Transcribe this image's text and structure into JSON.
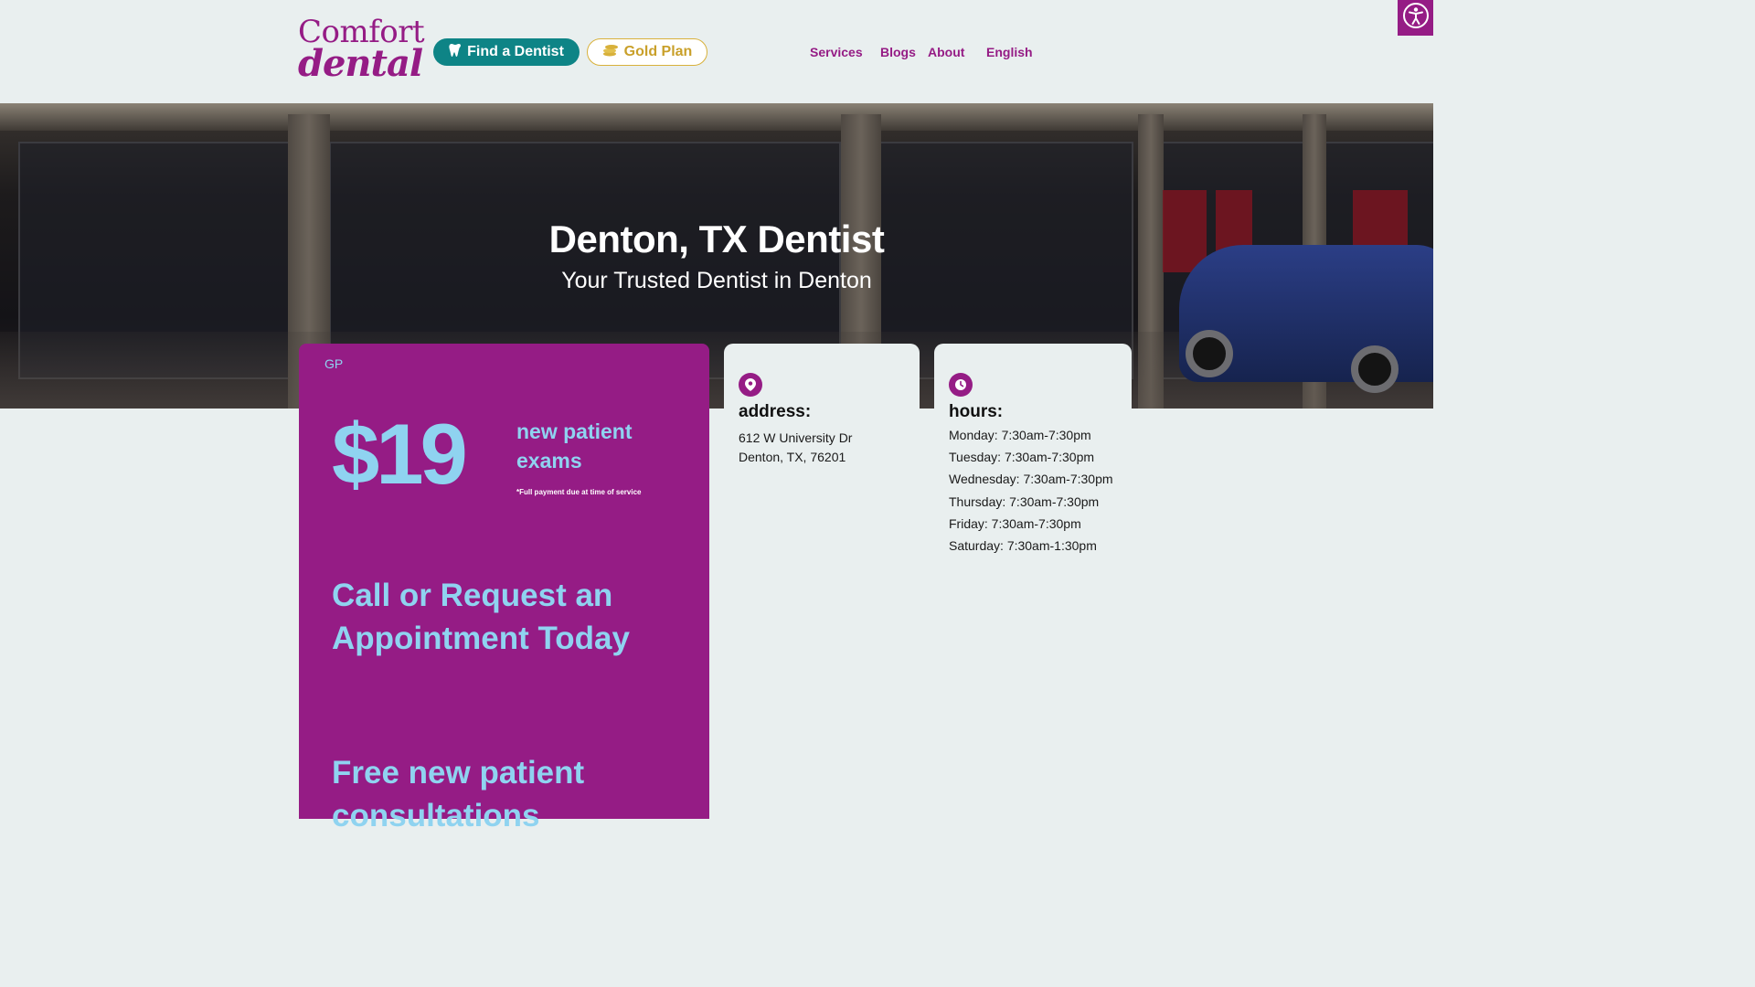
{
  "header": {
    "logo_top": "Comfort",
    "logo_bottom": "dental",
    "find_button": "Find a Dentist",
    "gold_button": "Gold Plan",
    "nav": [
      "Services",
      "Blogs",
      "About",
      "English"
    ]
  },
  "hero": {
    "title": "Denton, TX Dentist",
    "subtitle": "Your Trusted Dentist in Denton"
  },
  "promo": {
    "badge": "GP",
    "price": "$19",
    "price_label": "new patient exams",
    "fine_print": "*Full payment due at time of service",
    "cta": "Call or Request an Appointment Today",
    "free_text": "Free new patient consultations"
  },
  "address": {
    "heading": "address:",
    "line1": "612 W University Dr",
    "line2": "Denton, TX, 76201"
  },
  "hours": {
    "heading": "hours:",
    "days": [
      "Monday: 7:30am-7:30pm",
      "Tuesday: 7:30am-7:30pm",
      "Wednesday: 7:30am-7:30pm",
      "Thursday: 7:30am-7:30pm",
      "Friday: 7:30am-7:30pm",
      "Saturday: 7:30am-1:30pm"
    ]
  },
  "icons": {
    "find": "tooth-icon",
    "gold": "coins-icon",
    "address": "map-pin-icon",
    "hours": "clock-icon",
    "accessibility": "accessibility-icon"
  },
  "colors": {
    "brand_purple": "#951c85",
    "teal": "#0e8486",
    "gold": "#d8b13b",
    "light_blue": "#8fd3f0",
    "background": "#e9efef"
  }
}
